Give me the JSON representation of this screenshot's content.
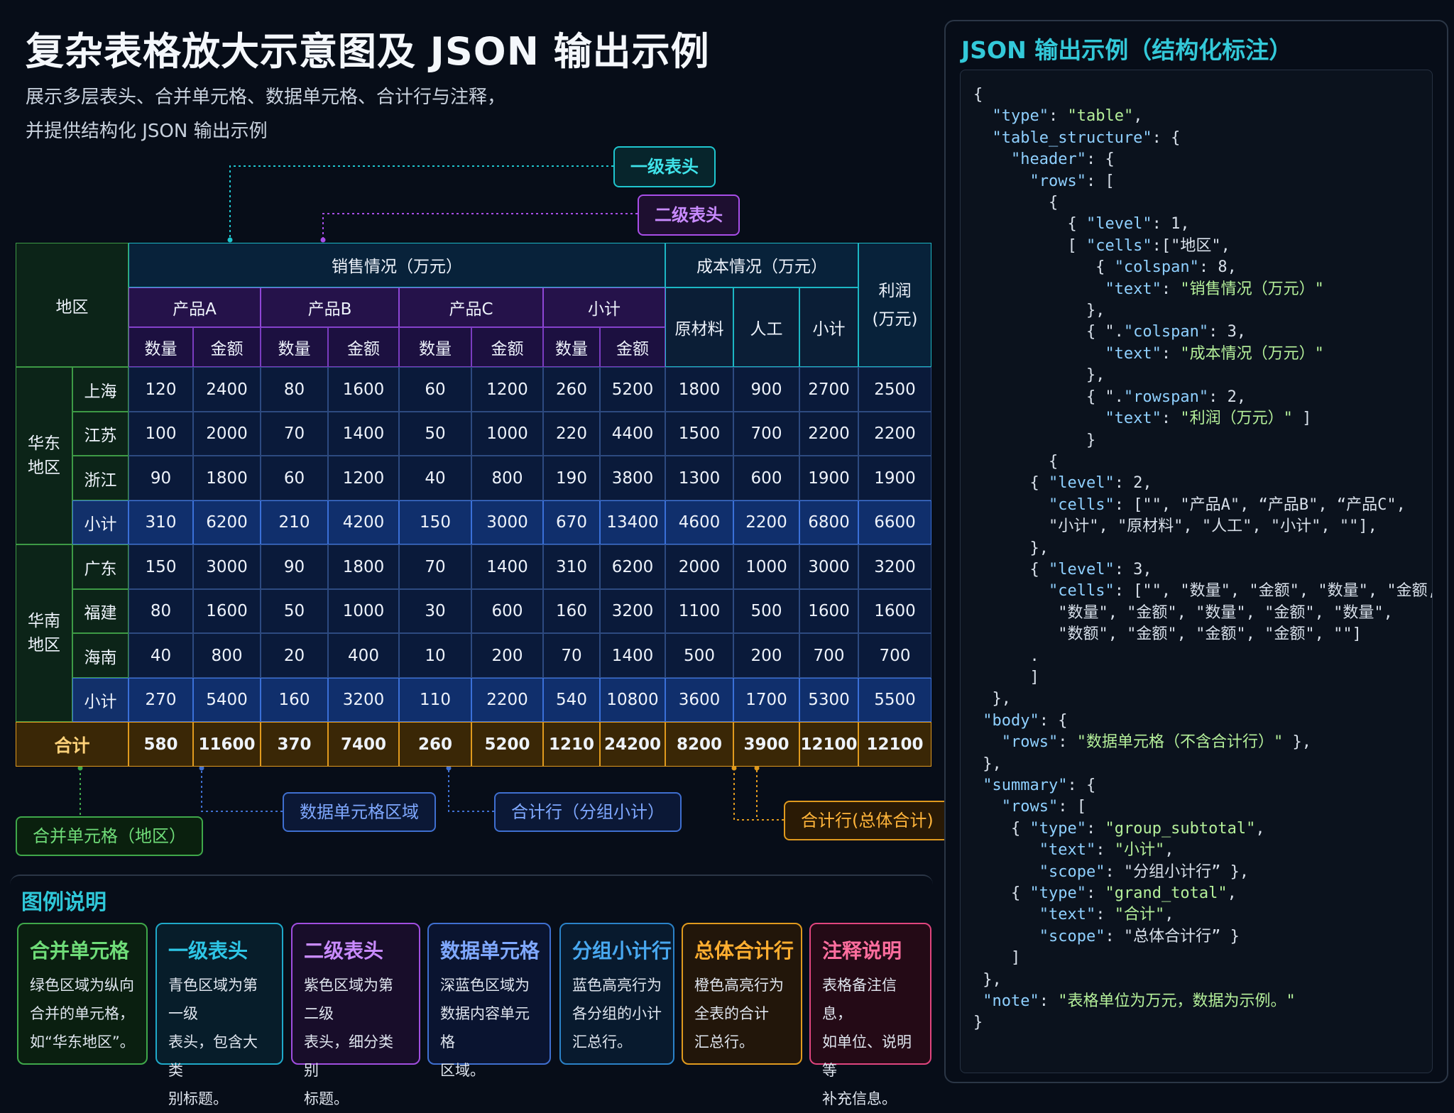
{
  "title": "复杂表格放大示意图及 JSON 输出示例",
  "subtitle_line1": "展示多层表头、合并单元格、数据单元格、合计行与注释，",
  "subtitle_line2": "并提供结构化 JSON 输出示例",
  "tags": {
    "level1_header": "一级表头",
    "level2_header": "二级表头",
    "data_cell_area": "数据单元格区域",
    "group_subtotal": "合计行（分组小计）",
    "grand_total": "合计行(总体合计)",
    "merged_region": "合并单元格（地区）"
  },
  "table": {
    "region_header": "地区",
    "sales_header": "销售情况（万元）",
    "cost_header": "成本情况（万元）",
    "profit_header_line1": "利润",
    "profit_header_line2": "(万元)",
    "products": [
      "产品A",
      "产品B",
      "产品C",
      "小计"
    ],
    "cost_cols": [
      "原材料",
      "人工",
      "小计"
    ],
    "qty": "数量",
    "amount": "金额",
    "groups": [
      {
        "name_line1": "华东",
        "name_line2": "地区",
        "rows": [
          {
            "name": "上海",
            "cells": [
              "120",
              "2400",
              "80",
              "1600",
              "60",
              "1200",
              "260",
              "5200",
              "1800",
              "900",
              "2700",
              "2500"
            ]
          },
          {
            "name": "江苏",
            "cells": [
              "100",
              "2000",
              "70",
              "1400",
              "50",
              "1000",
              "220",
              "4400",
              "1500",
              "700",
              "2200",
              "2200"
            ]
          },
          {
            "name": "浙江",
            "cells": [
              "90",
              "1800",
              "60",
              "1200",
              "40",
              "800",
              "190",
              "3800",
              "1300",
              "600",
              "1900",
              "1900"
            ]
          },
          {
            "name": "小计",
            "cells": [
              "310",
              "6200",
              "210",
              "4200",
              "150",
              "3000",
              "670",
              "13400",
              "4600",
              "2200",
              "6800",
              "6600"
            ]
          }
        ]
      },
      {
        "name_line1": "华南",
        "name_line2": "地区",
        "rows": [
          {
            "name": "广东",
            "cells": [
              "150",
              "3000",
              "90",
              "1800",
              "70",
              "1400",
              "310",
              "6200",
              "2000",
              "1000",
              "3000",
              "3200"
            ]
          },
          {
            "name": "福建",
            "cells": [
              "80",
              "1600",
              "50",
              "1000",
              "30",
              "600",
              "160",
              "3200",
              "1100",
              "500",
              "1600",
              "1600"
            ]
          },
          {
            "name": "海南",
            "cells": [
              "40",
              "800",
              "20",
              "400",
              "10",
              "200",
              "70",
              "1400",
              "500",
              "200",
              "700",
              "700"
            ]
          },
          {
            "name": "小计",
            "cells": [
              "270",
              "5400",
              "160",
              "3200",
              "110",
              "2200",
              "540",
              "10800",
              "3600",
              "1700",
              "5300",
              "5500"
            ]
          }
        ]
      }
    ],
    "total": {
      "name": "合计",
      "cells": [
        "580",
        "11600",
        "370",
        "7400",
        "260",
        "5200",
        "1210",
        "24200",
        "8200",
        "3900",
        "12100",
        "12100"
      ]
    }
  },
  "json_panel": {
    "title": "JSON 输出示例（结构化标注）",
    "code_lines": [
      "{",
      "  \"type\": \"table\",",
      "  \"table_structure\": {",
      "    \"header\": {",
      "      \"rows\": [",
      "        {",
      "          { \"level\": 1,",
      "          [ \"cells\":[\"地区\",",
      "             { \"colspan\": 8,",
      "              \"text\": \"销售情况（万元）\"",
      "            },",
      "            { \".\"colspan\": 3,",
      "              \"text\": \"成本情况（万元）\"",
      "            },",
      "            { \".\"rowspan\": 2,",
      "              \"text\": \"利润（万元）\" ]",
      "            }",
      "        {",
      "      { \"level\": 2,",
      "        \"cells\": [\"\", \"产品A\", “产品B\", “产品C\",",
      "        \"小计\", \"原材料\", \"人工\", \"小计\", \"\"],",
      "      },",
      "      { \"level\": 3,",
      "        \"cells\": [\"\", \"数量\", \"金额\", \"数量\", \"金额,",
      "         \"数量\", \"金额\", \"数量\", \"金额\", \"数量\",",
      "         \"数额\", \"金额\", \"金额\", \"金额\", \"\"]",
      "      .",
      "      ]",
      "  },",
      " \"body\": {",
      "   \"rows\": \"数据单元格（不含合计行）\" },",
      " },",
      " \"summary\": {",
      "   \"rows\": [",
      "    { \"type\": \"group_subtotal\",",
      "       \"text\": \"小计\",",
      "       \"scope\": \"分组小计行” },",
      "    { \"type\": \"grand_total\",",
      "       \"text\": \"合计\",",
      "       \"scope\": \"总体合计行” }",
      "    ]",
      " },",
      " \"note\": \"表格单位为万元，数据为示例。\"",
      "}"
    ]
  },
  "legend": {
    "title": "图例说明",
    "items": [
      {
        "title": "合并单元格",
        "lines": [
          "绿色区域为纵向",
          "合并的单元格，",
          "如“华东地区”。"
        ],
        "color": "#3fa84a",
        "text_color": "#6fdc78",
        "bg": "#0a1f10"
      },
      {
        "title": "一级表头",
        "lines": [
          "青色区域为第一级",
          "表头，包含大类",
          "别标题。"
        ],
        "color": "#1fa9c9",
        "text_color": "#2ec6e6",
        "bg": "#071d2a"
      },
      {
        "title": "二级表头",
        "lines": [
          "紫色区域为第二级",
          "表头，细分类别",
          "标题。"
        ],
        "color": "#a04ee0",
        "text_color": "#c98bff",
        "bg": "#180d2a"
      },
      {
        "title": "数据单元格",
        "lines": [
          "深蓝色区域为",
          "数据内容单元格",
          "区域。"
        ],
        "color": "#3f6fd0",
        "text_color": "#7fa8ff",
        "bg": "#0a1430"
      },
      {
        "title": "分组小计行",
        "lines": [
          "蓝色高亮行为",
          "各分组的小计",
          "汇总行。"
        ],
        "color": "#2b82c8",
        "text_color": "#48a8f0",
        "bg": "#081a2e"
      },
      {
        "title": "总体合计行",
        "lines": [
          "橙色高亮行为",
          "全表的合计",
          "汇总行。"
        ],
        "color": "#e09a1e",
        "text_color": "#ffae30",
        "bg": "#22160a"
      },
      {
        "title": "注释说明",
        "lines": [
          "表格备注信息，",
          "如单位、说明等",
          "补充信息。"
        ],
        "color": "#e0457e",
        "text_color": "#ff6e9e",
        "bg": "#240a16"
      }
    ]
  },
  "colors": {
    "background": "#070d18",
    "green": "#3fa84a",
    "cyan": "#1fc6cf",
    "purple": "#a84ee8",
    "blue": "#3f6fd0",
    "orange": "#e09a1e",
    "pink": "#e0457e"
  }
}
